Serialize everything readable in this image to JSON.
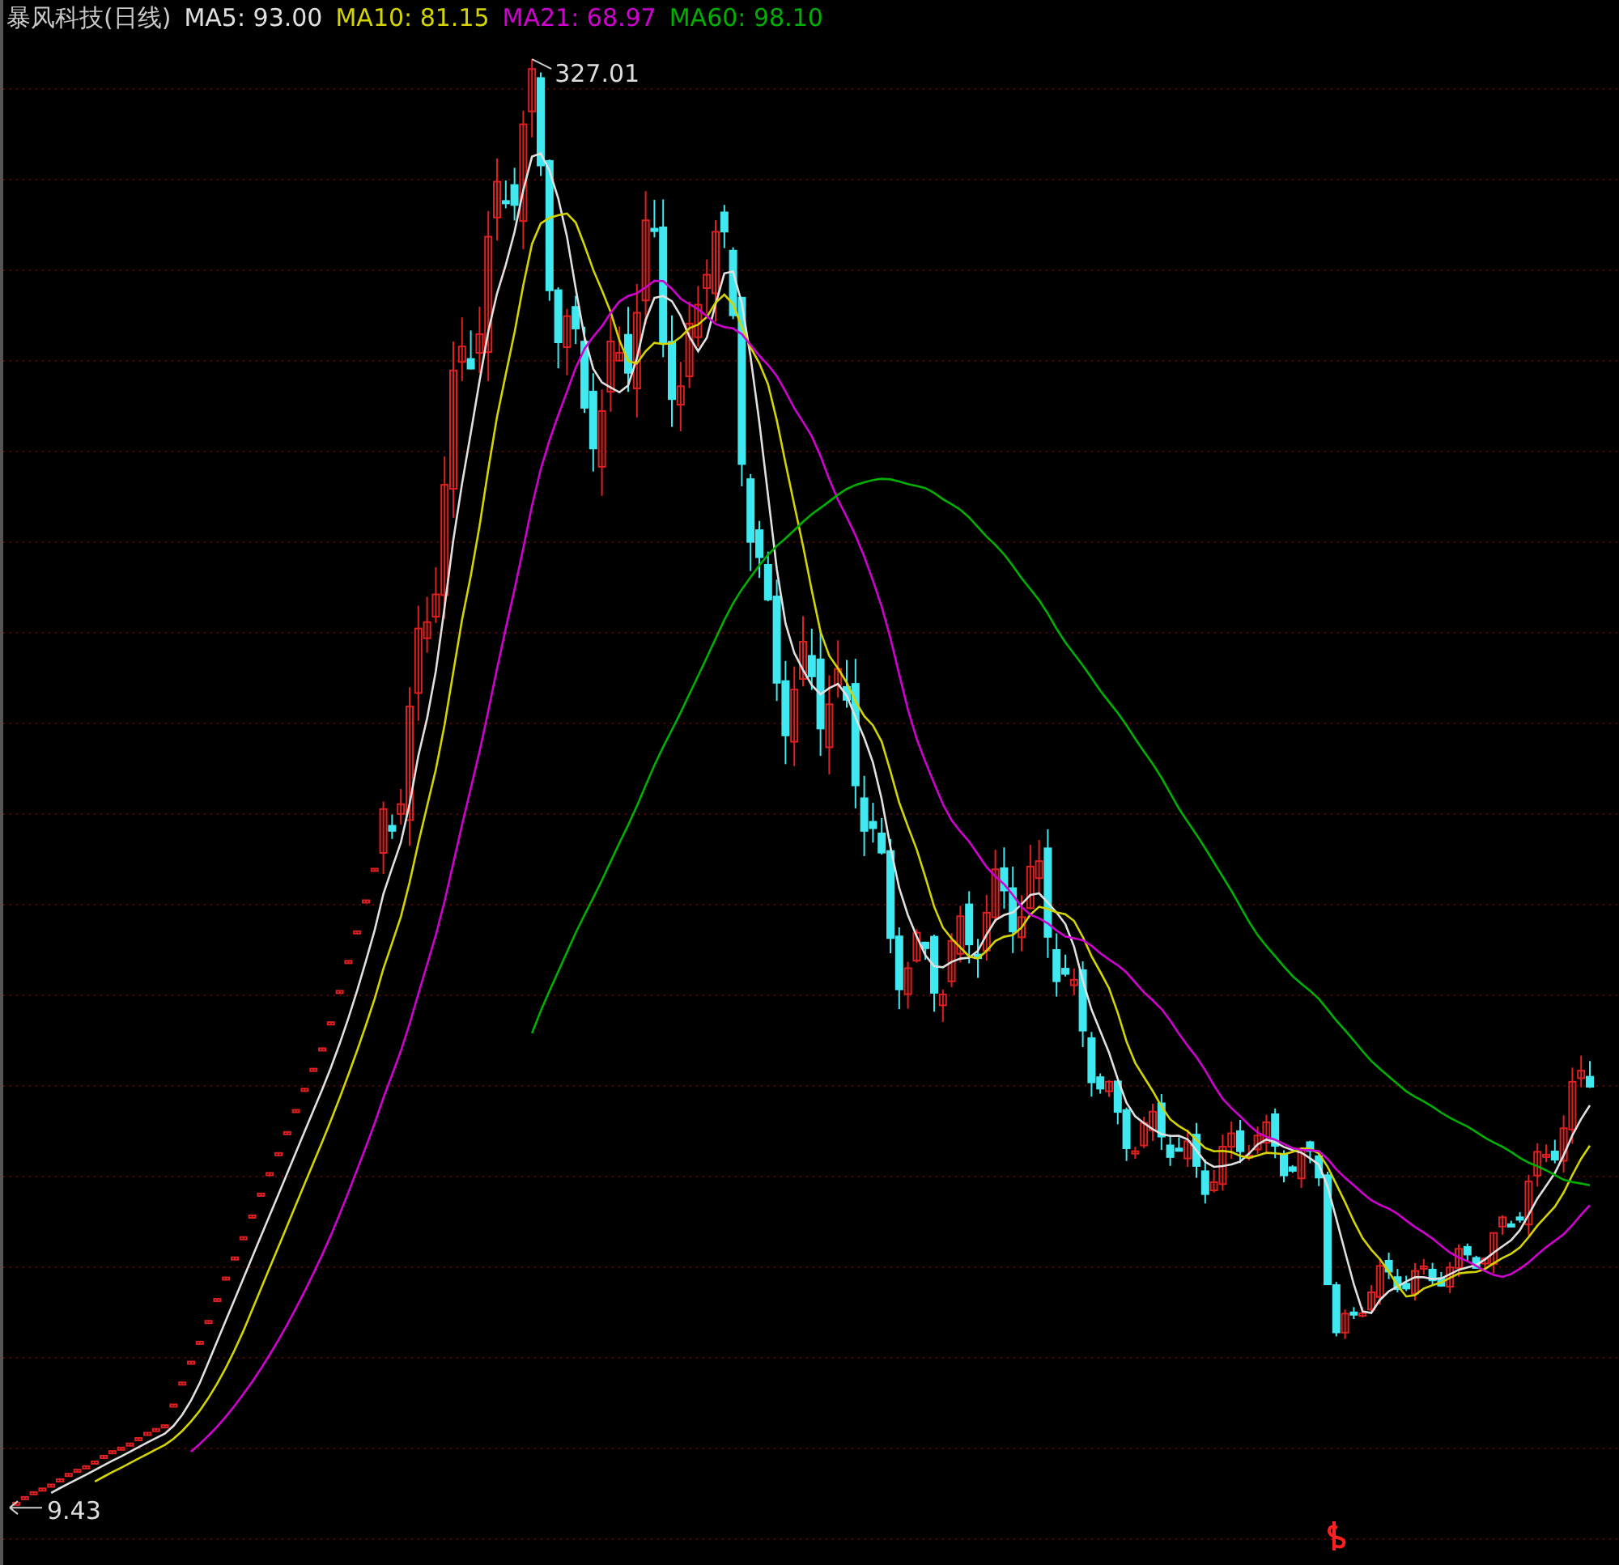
{
  "title": "暴风科技(日线)",
  "indicators": [
    {
      "text": "MA5: 93.00",
      "color": "#e0e0e0"
    },
    {
      "text": "MA10: 81.15",
      "color": "#d4d400"
    },
    {
      "text": "MA21: 68.97",
      "color": "#d000d0"
    },
    {
      "text": "MA60: 98.10",
      "color": "#00b000"
    }
  ],
  "high_label": "327.01",
  "low_label": "9.43"
}
